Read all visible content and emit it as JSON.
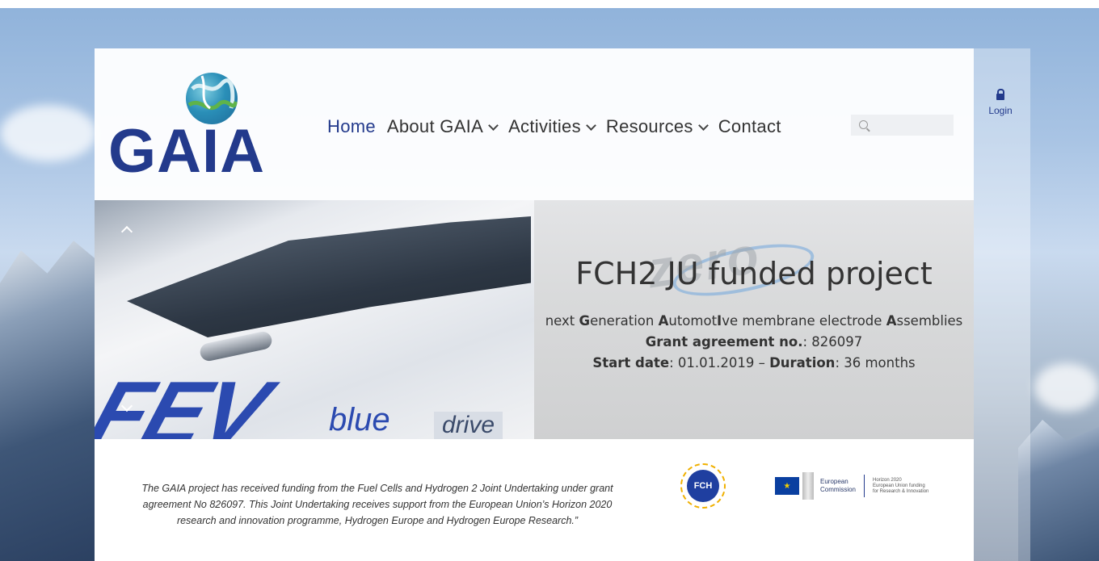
{
  "nav": {
    "items": [
      {
        "label": "Home",
        "active": true,
        "dropdown": false
      },
      {
        "label": "About GAIA",
        "active": false,
        "dropdown": true
      },
      {
        "label": "Activities",
        "active": false,
        "dropdown": true
      },
      {
        "label": "Resources",
        "active": false,
        "dropdown": true
      },
      {
        "label": "Contact",
        "active": false,
        "dropdown": false
      }
    ]
  },
  "logo": {
    "text": "GAIA"
  },
  "search": {
    "placeholder": ""
  },
  "login": {
    "label": "Login"
  },
  "slide": {
    "image_text": {
      "brand": "FEV",
      "sub": "blue",
      "drive": "drive",
      "watermark": "zero"
    },
    "title": "FCH2 JU funded project",
    "line1_parts": [
      {
        "text": "next ",
        "bold": false
      },
      {
        "text": "G",
        "bold": true
      },
      {
        "text": "eneration ",
        "bold": false
      },
      {
        "text": "A",
        "bold": true
      },
      {
        "text": "utomot",
        "bold": false
      },
      {
        "text": "I",
        "bold": true
      },
      {
        "text": "ve membrane electrode ",
        "bold": false
      },
      {
        "text": "A",
        "bold": true
      },
      {
        "text": "ssemblies",
        "bold": false
      }
    ],
    "grant_label": "Grant agreement no.",
    "grant_value": ": 826097",
    "start_label": "Start date",
    "start_value": ": 01.01.2019 – ",
    "duration_label": "Duration",
    "duration_value": ": 36 months"
  },
  "footer": {
    "disclaimer": "The GAIA project has received funding from the Fuel Cells and Hydrogen 2 Joint Undertaking under grant agreement No 826097. This Joint Undertaking receives support from the European Union’s Horizon 2020 research and innovation programme, Hydrogen Europe and Hydrogen Europe Research.”",
    "fch_logo_text": "FCH",
    "ec_text_1": "European",
    "ec_text_2": "Commission",
    "h2020_1": "Horizon 2020",
    "h2020_2": "European Union funding",
    "h2020_3": "for Research & Innovation"
  },
  "colors": {
    "brand": "#233a8c",
    "text": "#333333"
  }
}
